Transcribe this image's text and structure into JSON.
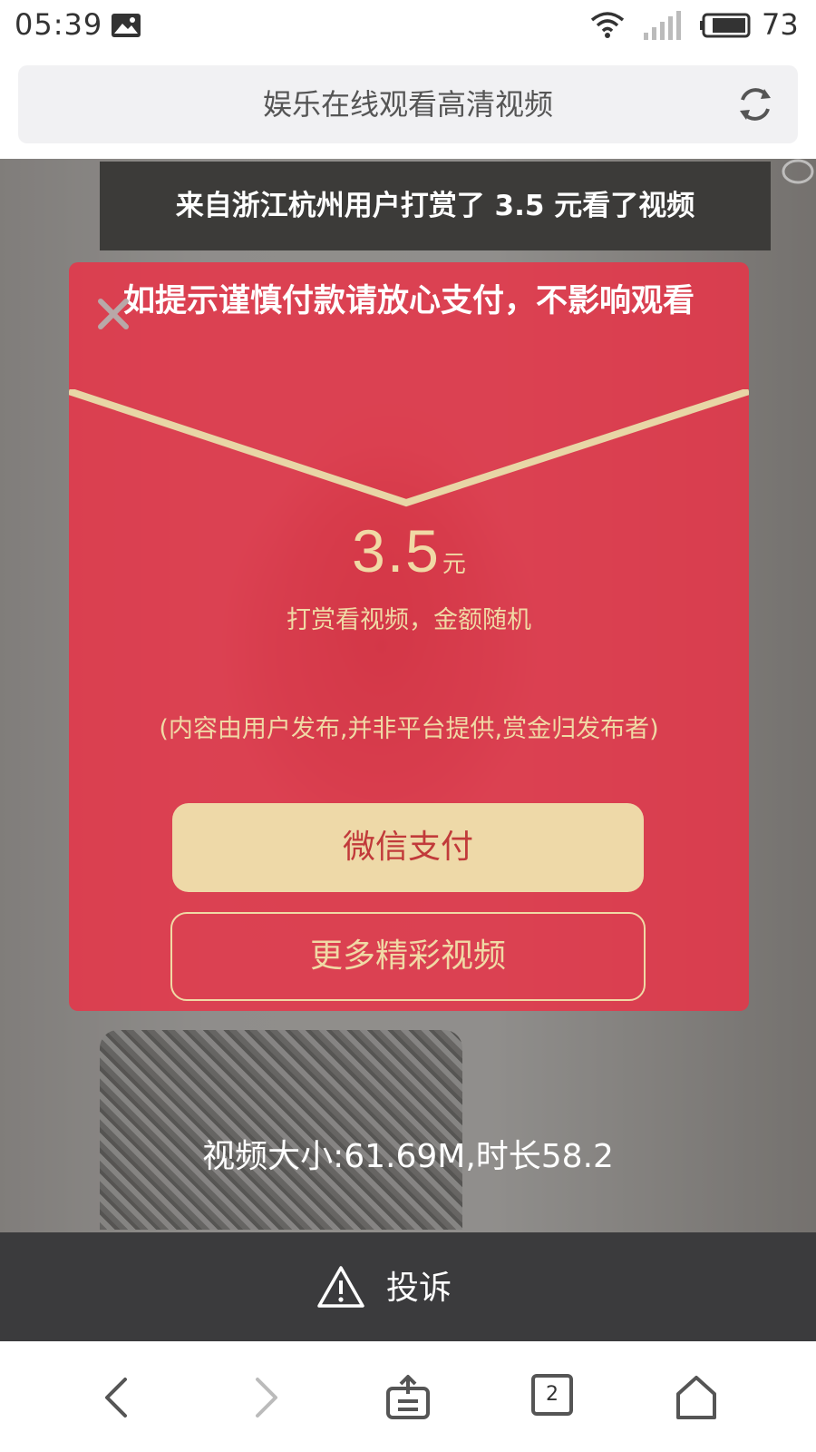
{
  "status_bar": {
    "time": "05:39",
    "battery_percent": "73",
    "notification_icon": "image-notification-icon",
    "wifi_icon": "wifi-icon",
    "signal_icon": "cell-signal-icon",
    "battery_icon": "battery-icon"
  },
  "address_bar": {
    "title": "娱乐在线观看高清视频",
    "reload_icon": "reload-icon"
  },
  "banner": {
    "text": "来自浙江杭州用户打赏了 3.5 元看了视频"
  },
  "modal": {
    "warning": "如提示谨慎付款请放心支付，不影响观看",
    "amount": "3.5",
    "unit": "元",
    "description": "打赏看视频，金额随机",
    "disclaimer": "(内容由用户发布,并非平台提供,赏金归发布者)",
    "pay_button": "微信支付",
    "more_button": "更多精彩视频",
    "colors": {
      "modal_red": "#e83448",
      "gold": "#f0d9a5",
      "pay_button_bg": "#eed9a8",
      "pay_button_text": "#c13a3a"
    }
  },
  "video_info": "视频大小:61.69M,时长58.2",
  "complaint": {
    "label": "投诉",
    "icon": "warning-triangle-icon"
  },
  "toolbar": {
    "tabs_count": "2",
    "icons": [
      "back-icon",
      "forward-icon",
      "share-icon",
      "tabs-icon",
      "home-icon"
    ]
  }
}
